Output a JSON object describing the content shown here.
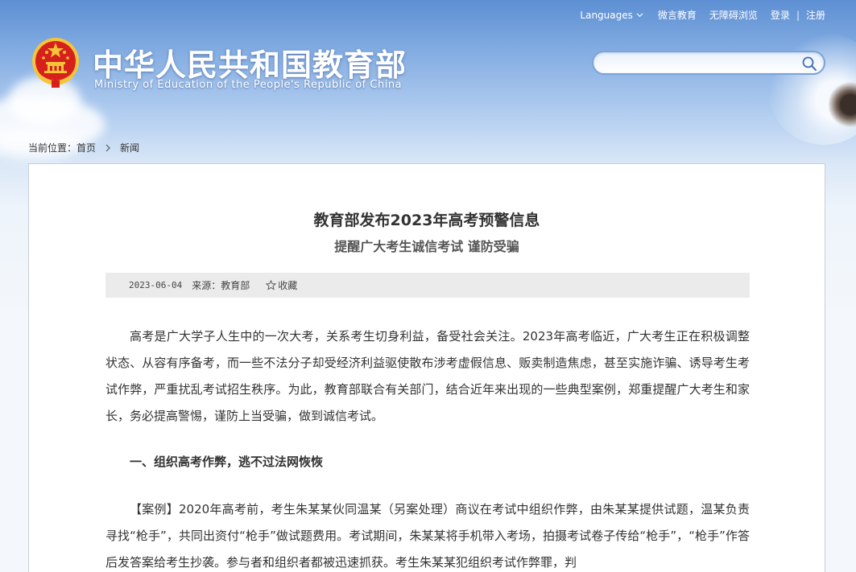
{
  "header": {
    "links": {
      "languages": "Languages",
      "weibo": "微言教育",
      "accessibility": "无障碍浏览",
      "login": "登录",
      "separator": "|",
      "register": "注册"
    },
    "site_title": "中华人民共和国教育部",
    "site_subtitle": "Ministry of Education of the People's Republic of China",
    "search": {
      "placeholder": ""
    }
  },
  "breadcrumb": {
    "label": "当前位置：",
    "home": "首页",
    "current": "新闻"
  },
  "article": {
    "title": "教育部发布2023年高考预警信息",
    "subtitle": "提醒广大考生诚信考试 谨防受骗",
    "meta": {
      "date": "2023-06-04",
      "source": "来源：教育部",
      "favorite": "收藏"
    },
    "paragraphs": [
      "高考是广大学子人生中的一次大考，关系考生切身利益，备受社会关注。2023年高考临近，广大考生正在积极调整状态、从容有序备考，而一些不法分子却受经济利益驱使散布涉考虚假信息、贩卖制造焦虑，甚至实施诈骗、诱导考生考试作弊，严重扰乱考试招生秩序。为此，教育部联合有关部门，结合近年来出现的一些典型案例，郑重提醒广大考生和家长，务必提高警惕，谨防上当受骗，做到诚信考试。"
    ],
    "section_heading": "一、组织高考作弊，逃不过法网恢恢",
    "case_paragraph": "【案例】2020年高考前，考生朱某某伙同温某（另案处理）商议在考试中组织作弊，由朱某某提供试题，温某负责寻找“枪手”，共同出资付“枪手”做试题费用。考试期间，朱某某将手机带入考场，拍摄考试卷子传给“枪手”，“枪手”作答后发答案给考生抄袭。参与者和组织者都被迅速抓获。考生朱某某犯组织考试作弊罪，判"
  },
  "colors": {
    "sky_top": "#5d8fd3",
    "title_text": "#333333",
    "meta_bg": "#ebebeb",
    "emblem_red": "#d6201c",
    "emblem_gold": "#f4c53a"
  }
}
